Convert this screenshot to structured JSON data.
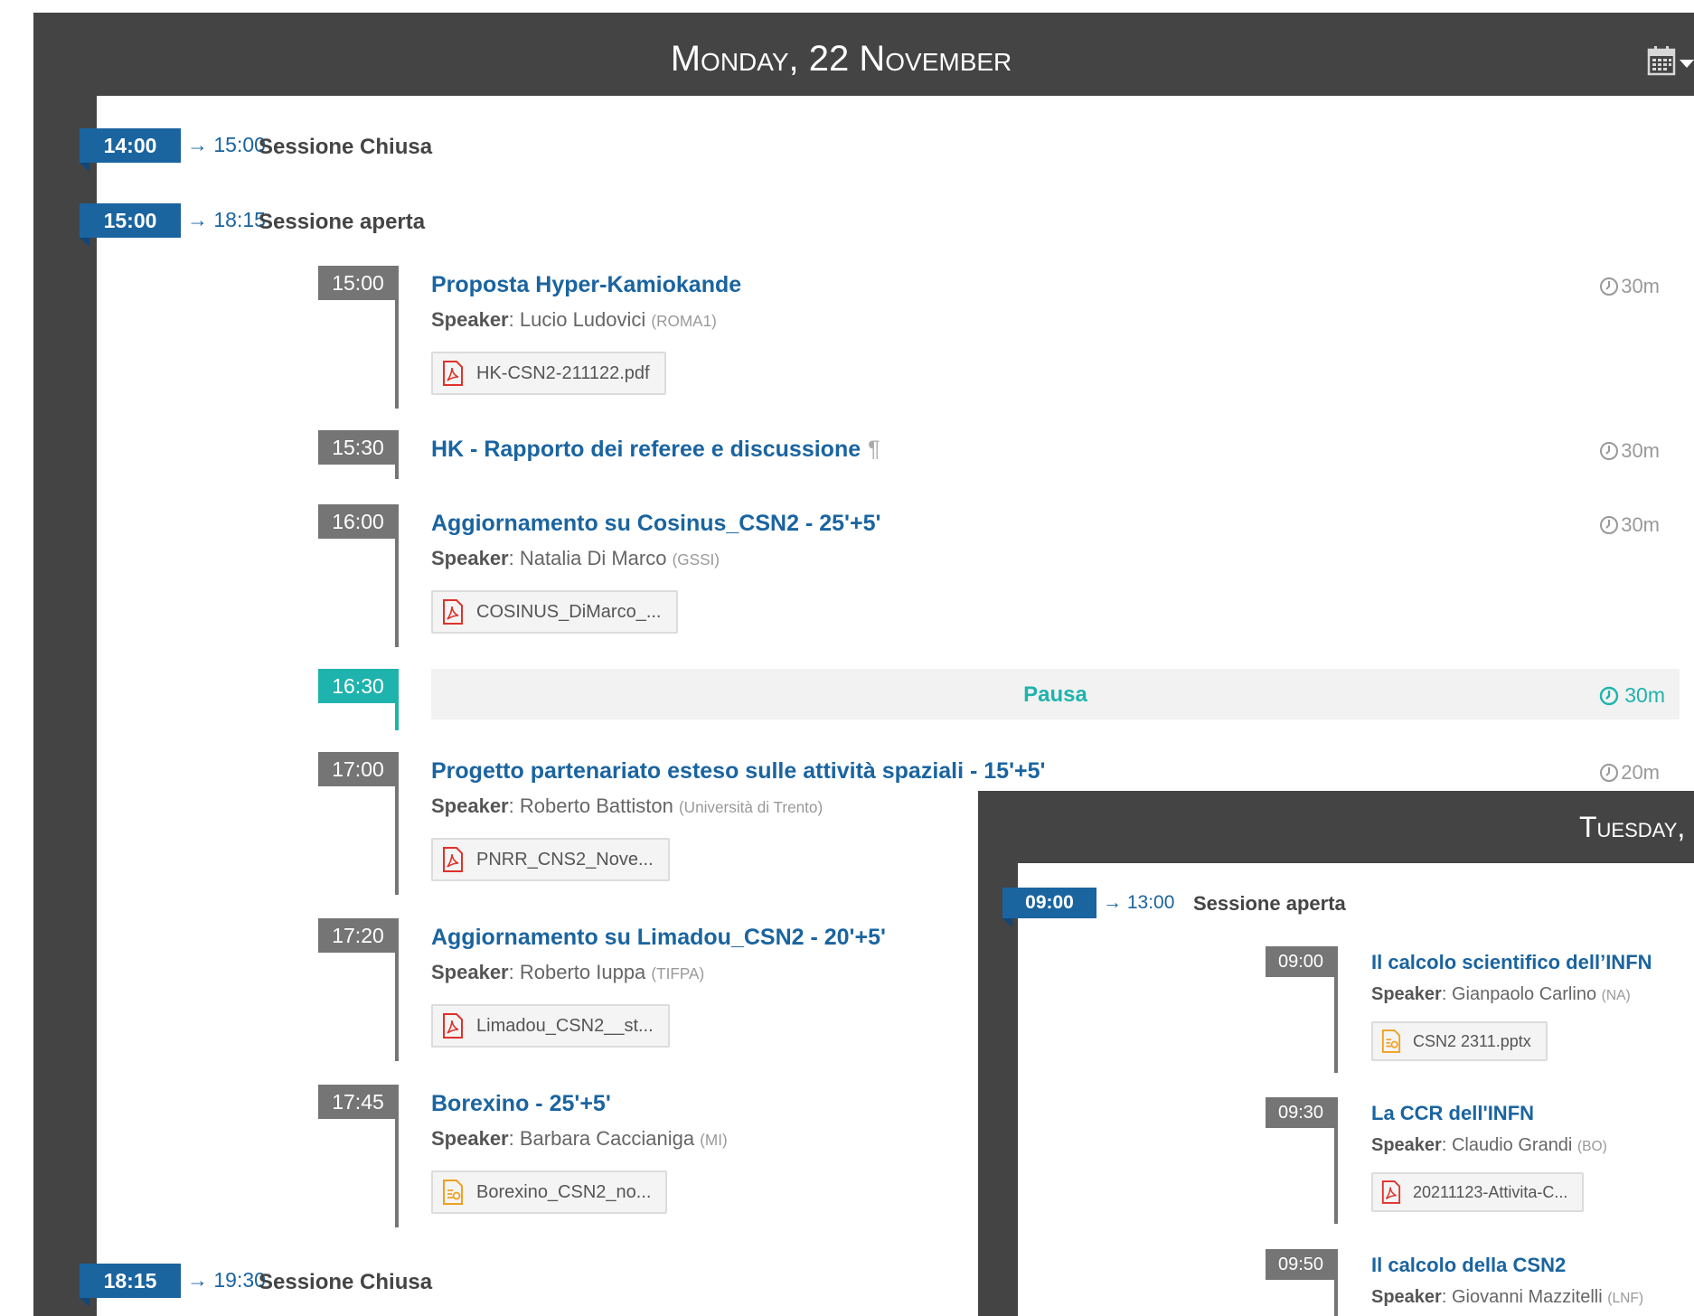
{
  "monday": {
    "header": "Monday, 22 November",
    "sessions": [
      {
        "start": "14:00",
        "end": "→ 15:00",
        "title": "Sessione Chiusa"
      },
      {
        "start": "15:00",
        "end": "→ 18:15",
        "title": "Sessione aperta"
      },
      {
        "start": "18:15",
        "end": "→ 19:30",
        "title": "Sessione Chiusa"
      }
    ],
    "contributions": [
      {
        "time": "15:00",
        "title": "Proposta Hyper-Kamiokande",
        "speaker_label": "Speaker",
        "speaker": "Lucio Ludovici",
        "affiliation": "(ROMA1)",
        "file": "HK-CSN2-211122.pdf",
        "file_type": "pdf",
        "duration": "30m"
      },
      {
        "time": "15:30",
        "title": "HK - Rapporto dei referee e discussione",
        "pilcrow": "¶",
        "duration": "30m"
      },
      {
        "time": "16:00",
        "title": "Aggiornamento su Cosinus_CSN2 - 25'+5'",
        "speaker_label": "Speaker",
        "speaker": "Natalia Di Marco",
        "affiliation": "(GSSI)",
        "file": "COSINUS_DiMarco_...",
        "file_type": "pdf",
        "duration": "30m"
      },
      {
        "time": "17:00",
        "title": "Progetto partenariato esteso sulle attività spaziali - 15'+5'",
        "speaker_label": "Speaker",
        "speaker": "Roberto Battiston",
        "affiliation": "(Università di Trento)",
        "file": "PNRR_CNS2_Nove...",
        "file_type": "pdf",
        "duration": "20m"
      },
      {
        "time": "17:20",
        "title": "Aggiornamento su Limadou_CSN2 - 20'+5'",
        "speaker_label": "Speaker",
        "speaker": "Roberto Iuppa",
        "affiliation": "(TIFPA)",
        "file": "Limadou_CSN2__st...",
        "file_type": "pdf"
      },
      {
        "time": "17:45",
        "title": "Borexino - 25'+5'",
        "speaker_label": "Speaker",
        "speaker": "Barbara Caccianiga",
        "affiliation": "(MI)",
        "file": "Borexino_CSN2_no...",
        "file_type": "slides"
      }
    ],
    "break": {
      "time": "16:30",
      "title": "Pausa",
      "duration": "30m"
    }
  },
  "tuesday": {
    "header": "Tuesday,",
    "session": {
      "start": "09:00",
      "end": "→ 13:00",
      "title": "Sessione aperta"
    },
    "contributions": [
      {
        "time": "09:00",
        "title": "Il calcolo scientifico dell’INFN",
        "speaker_label": "Speaker",
        "speaker": "Gianpaolo Carlino",
        "affiliation": "(NA)",
        "file": "CSN2 2311.pptx",
        "file_type": "slides"
      },
      {
        "time": "09:30",
        "title": "La CCR dell'INFN",
        "speaker_label": "Speaker",
        "speaker": "Claudio Grandi",
        "affiliation": "(BO)",
        "file": "20211123-Attivita-C...",
        "file_type": "pdf"
      },
      {
        "time": "09:50",
        "title": "Il calcolo della CSN2",
        "speaker_label": "Speaker",
        "speaker": "Giovanni Mazzitelli",
        "affiliation": "(LNF)"
      }
    ]
  },
  "colors": {
    "panel": "#444444",
    "session_flag": "#1a64a0",
    "time_box": "#757575",
    "break": "#1fb3ad",
    "link": "#1a64a0",
    "pdf_icon": "#e0312a",
    "slides_icon": "#f0a020"
  },
  "icons": {
    "calendar": "calendar-icon",
    "clock": "clock-icon",
    "pdf": "pdf-file-icon",
    "slides": "slides-file-icon"
  }
}
